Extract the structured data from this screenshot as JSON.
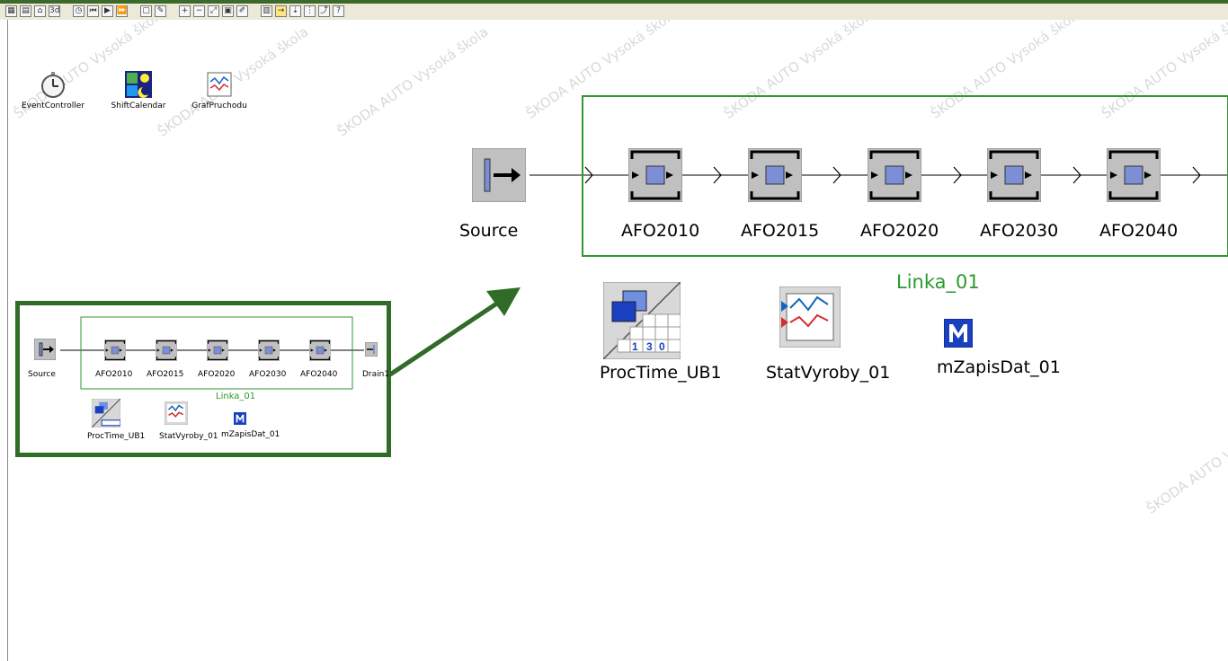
{
  "toolbar": {
    "icons": [
      "grid-icon",
      "layout-icon",
      "home-icon",
      "3d-icon",
      "clock-icon",
      "reset-icon",
      "play-icon",
      "fast-forward-icon",
      "frame-icon",
      "brush-icon",
      "zoom-in-icon",
      "zoom-out-icon",
      "fit-icon",
      "chart-icon",
      "pen-icon",
      "chart2-icon",
      "connector-icon",
      "inherit-icon",
      "grid2-icon",
      "graph-icon",
      "help-icon"
    ]
  },
  "watermarks": [
    "ŠKODA AUTO Vysoká škola"
  ],
  "tools": [
    {
      "label": "EventController",
      "icon": "stopwatch-icon"
    },
    {
      "label": "ShiftCalendar",
      "icon": "calendar-icon"
    },
    {
      "label": "GrafPruchodu",
      "icon": "chart-icon"
    }
  ],
  "main": {
    "source_label": "Source",
    "stations": [
      "AFO2010",
      "AFO2015",
      "AFO2020",
      "AFO2030",
      "AFO2040"
    ],
    "line_label": "Linka_01",
    "objects": [
      {
        "label": "ProcTime_UB1",
        "icon": "table-file-icon"
      },
      {
        "label": "StatVyroby_01",
        "icon": "statistics-chart-icon"
      },
      {
        "label": "mZapisDat_01",
        "icon": "method-icon"
      }
    ]
  },
  "mini": {
    "source_label": "Source",
    "stations": [
      "AFO2010",
      "AFO2015",
      "AFO2020",
      "AFO2030",
      "AFO2040"
    ],
    "drain_label": "Drain1",
    "line_label": "Linka_01",
    "objects": [
      "ProcTime_UB1",
      "StatVyroby_01",
      "mZapisDat_01"
    ],
    "table_digits": [
      "1",
      "3",
      "0"
    ]
  },
  "colors": {
    "accent_green": "#2f6d27",
    "line_green": "#2f9a2f"
  }
}
